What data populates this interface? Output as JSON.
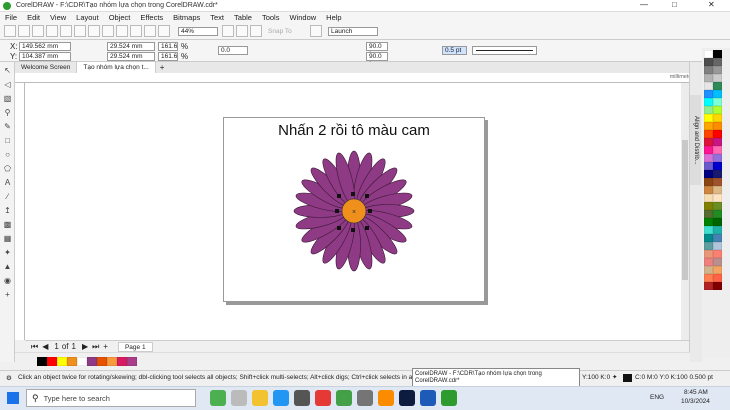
{
  "window": {
    "title": "CorelDRAW - F:\\CDR\\Tạo nhóm lựa chọn trong CorelDRAW.cdr*"
  },
  "menu": [
    "File",
    "Edit",
    "View",
    "Layout",
    "Object",
    "Effects",
    "Bitmaps",
    "Text",
    "Table",
    "Tools",
    "Window",
    "Help"
  ],
  "toolbar": {
    "zoom": "44%",
    "snap": "Snap To",
    "launch": "Launch"
  },
  "props": {
    "x": "149.562 mm",
    "y": "104.387 mm",
    "w": "29.524 mm",
    "h": "29.524 mm",
    "sx": "161.6",
    "sy": "161.6",
    "pct": "%",
    "angle": "0.0",
    "arc1": "90.0 °",
    "arc2": "90.0 °",
    "outline": "0.5 pt"
  },
  "tabs": [
    "Welcome Screen",
    "Tạo nhóm lựa chọn t..."
  ],
  "ruler_unit": "millimeters",
  "page": {
    "title": "Nhấn 2 rồi tô màu cam"
  },
  "flower": {
    "petal_color": "#8e3a84",
    "center_color": "#f0901c",
    "petal_count": 24
  },
  "pagenav": {
    "current": "1",
    "of": "of",
    "total": "1",
    "page_tab": "Page 1"
  },
  "docker_tab": "Align and Distrib...",
  "status": {
    "hint": "Click an object twice for rotating/skewing; dbl-clicking tool selects all objects; Shift+click multi-selects; Alt+click digs; Ctrl+click selects in a...",
    "fill": "Y:100 K:0",
    "outline": "C:0 M:0 Y:0 K:100  0.500 pt"
  },
  "tooltip": "CorelDRAW - F:\\CDR\\Tạo nhóm lựa chọn trong CorelDRAW.cdr*",
  "taskbar": {
    "search_placeholder": "Type here to search",
    "time": "8:45 AM",
    "date": "10/3/2024",
    "lang": "ENG"
  },
  "palette": [
    "#ffffff",
    "#000000",
    "#4d4d4d",
    "#666666",
    "#808080",
    "#999999",
    "#b3b3b3",
    "#cccccc",
    "#e6e6e6",
    "#2e8b57",
    "#1e90ff",
    "#00bfff",
    "#00ffff",
    "#7fffd4",
    "#90ee90",
    "#adff2f",
    "#ffff00",
    "#ffd700",
    "#ffa500",
    "#ff8c00",
    "#ff4500",
    "#ff0000",
    "#dc143c",
    "#c71585",
    "#ff1493",
    "#ff69b4",
    "#da70d6",
    "#9370db",
    "#6a5acd",
    "#0000cd",
    "#000080",
    "#191970",
    "#8b4513",
    "#a0522d",
    "#cd853f",
    "#deb887",
    "#f5deb3",
    "#ffe4c4",
    "#808000",
    "#6b8e23",
    "#556b2f",
    "#228b22",
    "#008000",
    "#006400",
    "#40e0d0",
    "#20b2aa",
    "#008b8b",
    "#4682b4",
    "#5f9ea0",
    "#b0c4de",
    "#e9967a",
    "#fa8072",
    "#f08080",
    "#bc8f8f",
    "#d2b48c",
    "#f4a460",
    "#ff7f50",
    "#ff6347",
    "#b22222",
    "#800000"
  ],
  "doc_palette": [
    "#000000",
    "#ff0000",
    "#ffff00",
    "#f0901c",
    "#ffffff",
    "#8e3a84",
    "#e65100",
    "#f59b3b",
    "#d81b60",
    "#aa3d8a"
  ]
}
